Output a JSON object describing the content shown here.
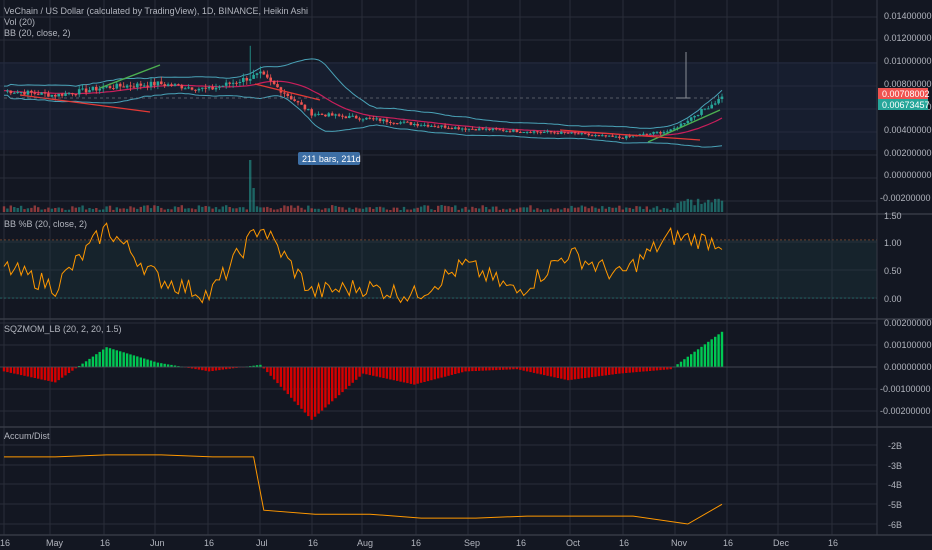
{
  "header": {
    "title": "VeChain / US Dollar (calculated by TradingView), 1D, BINANCE, Heikin Ashi",
    "vol_label": "Vol (20)",
    "bb_label": "BB (20, close, 2)"
  },
  "colors": {
    "background": "#131722",
    "grid": "#2a2e39",
    "up": "#26a69a",
    "down": "#ef5350",
    "bb_band": "#4aa3b8",
    "bb_basis": "#e91e63",
    "trend_green": "#4caf50",
    "trend_red": "#e53935",
    "pct_line": "#ff9800",
    "hist_green": "#00c853",
    "hist_red": "#d50000",
    "accum_line": "#ff9800",
    "tag_red": "#ef5350",
    "tag_teal": "#26a69a",
    "measure_tag": "#3d6fa5"
  },
  "price_pane": {
    "y_ticks": [
      "0.01400000",
      "0.01200000",
      "0.01000000",
      "0.00800000",
      "0.00600000",
      "0.00400000",
      "0.00200000",
      "0.00000000",
      "-0.00200000"
    ],
    "last_price_red": "0.00708002",
    "last_price_teal": "0.00673457",
    "measure_label": "211 bars, 211d"
  },
  "pct_pane": {
    "label": "BB %B (20, close, 2)",
    "y_ticks": [
      "1.50",
      "1.00",
      "0.50",
      "0.00"
    ]
  },
  "mom_pane": {
    "label": "SQZMOM_LB (20, 2, 20, 1.5)",
    "y_ticks": [
      "0.00200000",
      "0.00100000",
      "0.00000000",
      "-0.00100000",
      "-0.00200000"
    ]
  },
  "accum_pane": {
    "label": "Accum/Dist",
    "y_ticks": [
      "-2B",
      "-3B",
      "-4B",
      "-5B",
      "-6B"
    ]
  },
  "x_axis": {
    "labels": [
      "16",
      "May",
      "16",
      "Jun",
      "16",
      "Jul",
      "16",
      "Aug",
      "16",
      "Sep",
      "16",
      "Oct",
      "16",
      "Nov",
      "16",
      "Dec",
      "16"
    ]
  },
  "chart_data": [
    {
      "type": "candlestick",
      "title": "VeChain / US Dollar (calculated by TradingView), 1D, BINANCE, Heikin Ashi",
      "x_dates": [
        "Apr 16",
        "May 1",
        "May 16",
        "Jun 1",
        "Jun 16",
        "Jul 1",
        "Jul 16",
        "Aug 1",
        "Aug 16",
        "Sep 1",
        "Sep 16",
        "Oct 1",
        "Oct 16",
        "Nov 1",
        "Nov 12"
      ],
      "close": [
        0.0076,
        0.0072,
        0.0079,
        0.0082,
        0.0077,
        0.009,
        0.0056,
        0.0052,
        0.0047,
        0.0043,
        0.0041,
        0.0039,
        0.0035,
        0.0041,
        0.007
      ],
      "ylim": [
        -0.003,
        0.0155
      ],
      "last_price": 0.00708002,
      "bb_last": 0.00673457
    },
    {
      "type": "bar",
      "title": "Vol (20)"
    },
    {
      "type": "line",
      "title": "BB %B (20, close, 2)",
      "x_dates": [
        "Apr 16",
        "May 1",
        "May 16",
        "Jun 1",
        "Jun 16",
        "Jul 1",
        "Jul 16",
        "Aug 1",
        "Aug 16",
        "Sep 1",
        "Sep 16",
        "Oct 1",
        "Oct 16",
        "Nov 1",
        "Nov 12"
      ],
      "values": [
        0.55,
        0.2,
        1.25,
        0.35,
        0.05,
        1.3,
        0.1,
        0.2,
        0.05,
        0.6,
        0.1,
        0.8,
        0.4,
        1.1,
        1.0
      ],
      "ylim": [
        -0.15,
        1.55
      ]
    },
    {
      "type": "bar",
      "title": "SQZMOM_LB (20, 2, 20, 1.5)",
      "x_dates": [
        "Apr 16",
        "May 1",
        "May 16",
        "Jun 1",
        "Jun 16",
        "Jul 1",
        "Jul 16",
        "Aug 1",
        "Aug 16",
        "Sep 1",
        "Sep 16",
        "Oct 1",
        "Oct 16",
        "Nov 1",
        "Nov 12"
      ],
      "values": [
        -0.0002,
        -0.0007,
        0.0009,
        0.0002,
        -0.0002,
        0.0001,
        -0.0024,
        -0.0003,
        -0.0008,
        -0.0002,
        -0.0001,
        -0.0006,
        -0.0003,
        -0.0001,
        0.0016
      ],
      "ylim": [
        -0.0026,
        0.0021
      ]
    },
    {
      "type": "line",
      "title": "Accum/Dist",
      "x_dates": [
        "Apr 16",
        "May 1",
        "May 16",
        "Jun 1",
        "Jun 16",
        "Jun 28",
        "Jul 1",
        "Jul 16",
        "Aug 1",
        "Aug 16",
        "Sep 1",
        "Sep 16",
        "Oct 1",
        "Oct 16",
        "Nov 1",
        "Nov 12"
      ],
      "values_billions": [
        -2.4,
        -2.4,
        -2.3,
        -2.3,
        -2.4,
        -2.4,
        -5.1,
        -5.3,
        -5.3,
        -5.5,
        -5.5,
        -5.4,
        -5.4,
        -5.4,
        -5.8,
        -4.8
      ],
      "ylim": [
        -6.4,
        -1.6
      ]
    }
  ]
}
